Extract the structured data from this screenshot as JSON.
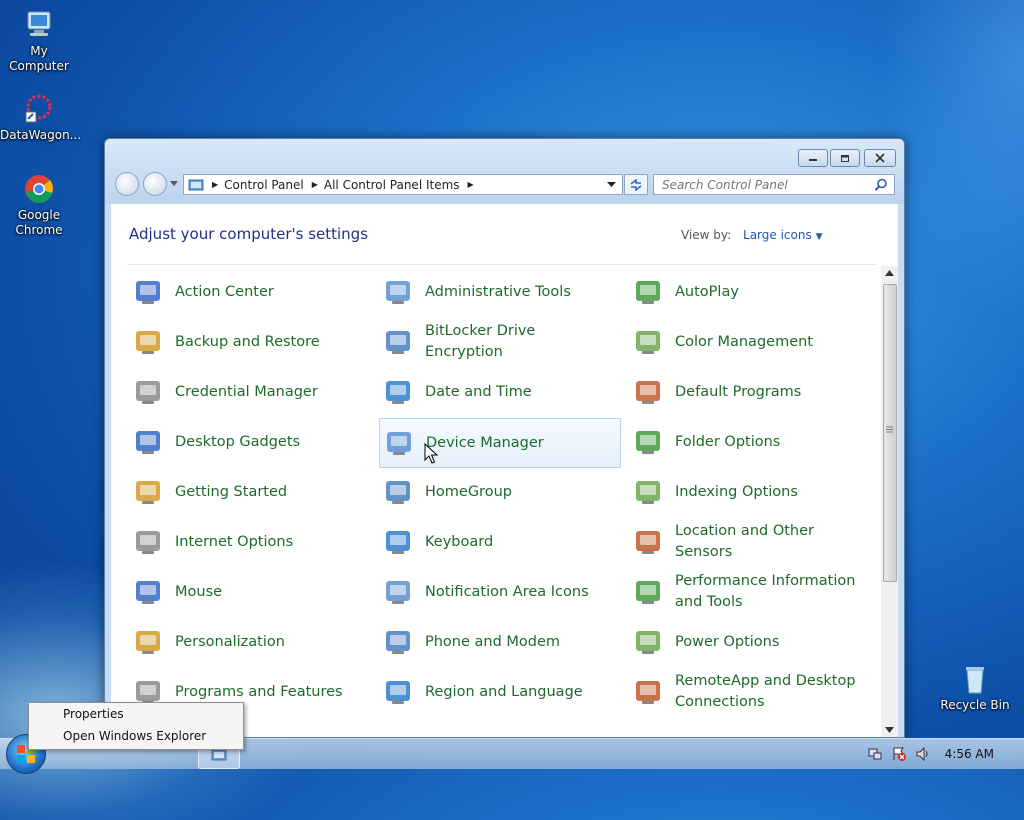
{
  "desktop": {
    "icons": [
      {
        "label": "My Computer"
      },
      {
        "label": "DataWagon..."
      },
      {
        "label": "Google Chrome"
      },
      {
        "label": "Recycle Bin"
      }
    ]
  },
  "window": {
    "breadcrumb": [
      "Control Panel",
      "All Control Panel Items"
    ],
    "search_placeholder": "Search Control Panel",
    "heading": "Adjust your computer's settings",
    "view_by_label": "View by:",
    "view_by_value": "Large icons",
    "items": [
      [
        "Action Center",
        "Administrative Tools",
        "AutoPlay"
      ],
      [
        "Backup and Restore",
        "BitLocker Drive Encryption",
        "Color Management"
      ],
      [
        "Credential Manager",
        "Date and Time",
        "Default Programs"
      ],
      [
        "Desktop Gadgets",
        "Device Manager",
        "Folder Options"
      ],
      [
        "Getting Started",
        "HomeGroup",
        "Indexing Options"
      ],
      [
        "Internet Options",
        "Keyboard",
        "Location and Other Sensors"
      ],
      [
        "Mouse",
        "Notification Area Icons",
        "Performance Information and Tools"
      ],
      [
        "Personalization",
        "Phone and Modem",
        "Power Options"
      ],
      [
        "Programs and Features",
        "Region and Language",
        "RemoteApp and Desktop Connections"
      ]
    ],
    "partial_visible_label": "and Features"
  },
  "context_menu": {
    "items": [
      "Properties",
      "Open Windows Explorer"
    ]
  },
  "taskbar": {
    "clock": "4:56 AM"
  },
  "colors": {
    "link_green": "#1e6a2a",
    "heading_blue": "#1e3287",
    "desktop_blue": "#1c6fc9"
  }
}
